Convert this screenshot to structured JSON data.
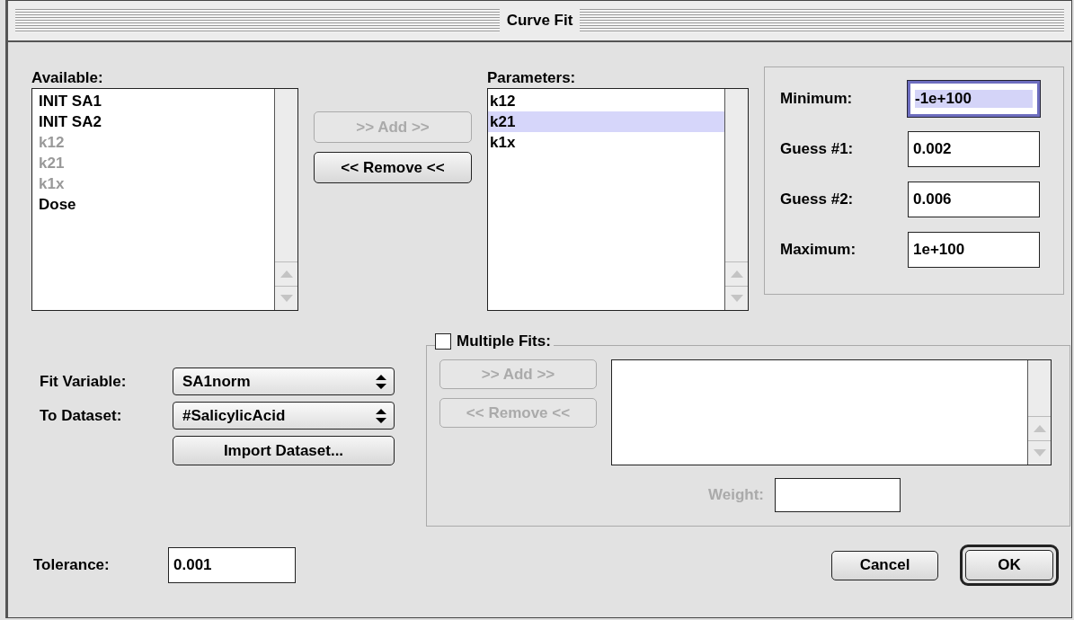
{
  "window": {
    "title": "Curve Fit"
  },
  "available": {
    "label": "Available:",
    "items": [
      {
        "label": "INIT SA1",
        "disabled": false
      },
      {
        "label": "INIT SA2",
        "disabled": false
      },
      {
        "label": "k12",
        "disabled": true
      },
      {
        "label": "k21",
        "disabled": true
      },
      {
        "label": "k1x",
        "disabled": true
      },
      {
        "label": "Dose",
        "disabled": false
      }
    ]
  },
  "add_button": {
    "label": ">> Add >>",
    "disabled": true
  },
  "remove_button": {
    "label": "<< Remove <<",
    "disabled": false
  },
  "parameters": {
    "label": "Parameters:",
    "items": [
      {
        "label": "k12",
        "selected": false
      },
      {
        "label": "k21",
        "selected": true
      },
      {
        "label": "k1x",
        "selected": false
      }
    ]
  },
  "bounds": [
    {
      "label": "Minimum:",
      "value": "-1e+100",
      "focused": true
    },
    {
      "label": "Guess #1:",
      "value": "0.002",
      "focused": false
    },
    {
      "label": "Guess #2:",
      "value": "0.006",
      "focused": false
    },
    {
      "label": "Maximum:",
      "value": "1e+100",
      "focused": false
    }
  ],
  "fit_variable": {
    "label": "Fit Variable:",
    "value": "SA1norm"
  },
  "to_dataset": {
    "label": "To Dataset:",
    "value": "#SalicylicAcid"
  },
  "import_button": {
    "label": "Import Dataset..."
  },
  "multiple_fits": {
    "label": "Multiple Fits:",
    "checked": false,
    "add_button": {
      "label": ">> Add >>",
      "disabled": true
    },
    "remove_button": {
      "label": "<< Remove <<",
      "disabled": true
    },
    "weight": {
      "label": "Weight:",
      "disabled": true
    }
  },
  "tolerance": {
    "label": "Tolerance:",
    "value": "0.001"
  },
  "cancel_button": {
    "label": "Cancel"
  },
  "ok_button": {
    "label": "OK",
    "default": true
  }
}
